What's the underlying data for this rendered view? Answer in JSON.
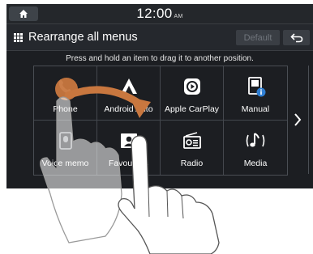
{
  "statusbar": {
    "home_icon": "home-icon",
    "time": "12:00",
    "ampm": "AM"
  },
  "titlebar": {
    "menu_icon": "grid-menu-icon",
    "title": "Rearrange all menus",
    "default_label": "Default",
    "back_icon": "return-arrow-icon"
  },
  "instruction": "Press and hold an item to drag it to another position.",
  "apps": [
    {
      "label": "Phone",
      "icon": "phone-icon"
    },
    {
      "label": "Android Auto",
      "icon": "android-auto-icon"
    },
    {
      "label": "Apple CarPlay",
      "icon": "apple-carplay-icon"
    },
    {
      "label": "Manual",
      "icon": "manual-icon"
    },
    {
      "label": "Voice memo",
      "icon": "voice-memo-icon"
    },
    {
      "label": "Favourites",
      "icon": "favourites-icon"
    },
    {
      "label": "Radio",
      "icon": "radio-icon"
    },
    {
      "label": "Media",
      "icon": "media-icon"
    }
  ],
  "pager": {
    "next_icon": "chevron-right-icon"
  },
  "colors": {
    "screen_bg": "#1c1e22",
    "bar_bg": "#25282d",
    "drag_highlight": "#c8773f",
    "text": "#ffffff",
    "disabled_text": "#70757c"
  }
}
